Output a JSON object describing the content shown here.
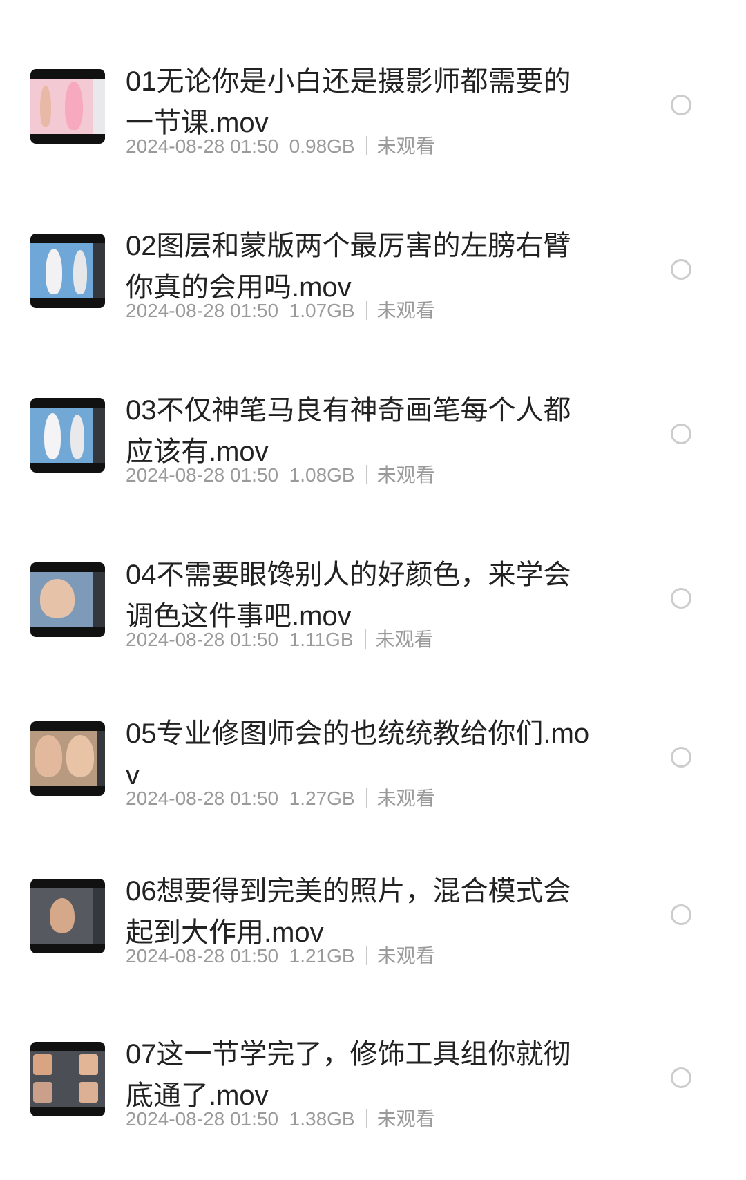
{
  "items": [
    {
      "title": "01无论你是小白还是摄影师都需要的一节课.mov",
      "date": "2024-08-28 01:50",
      "size": "0.98GB",
      "status": "未观看",
      "thumb": "pink"
    },
    {
      "title": "02图层和蒙版两个最厉害的左膀右臂你真的会用吗.mov",
      "date": "2024-08-28 01:50",
      "size": "1.07GB",
      "status": "未观看",
      "thumb": "sky"
    },
    {
      "title": "03不仅神笔马良有神奇画笔每个人都应该有.mov",
      "date": "2024-08-28 01:50",
      "size": "1.08GB",
      "status": "未观看",
      "thumb": "sky"
    },
    {
      "title": "04不需要眼馋别人的好颜色，来学会调色这件事吧.mov",
      "date": "2024-08-28 01:50",
      "size": "1.11GB",
      "status": "未观看",
      "thumb": "portrait"
    },
    {
      "title": "05专业修图师会的也统统教给你们.mov",
      "date": "2024-08-28 01:50",
      "size": "1.27GB",
      "status": "未观看",
      "thumb": "faces"
    },
    {
      "title": "06想要得到完美的照片，混合模式会起到大作用.mov",
      "date": "2024-08-28 01:50",
      "size": "1.21GB",
      "status": "未观看",
      "thumb": "dark"
    },
    {
      "title": "07这一节学完了，修饰工具组你就彻底通了.mov",
      "date": "2024-08-28 01:50",
      "size": "1.38GB",
      "status": "未观看",
      "thumb": "grid"
    }
  ]
}
